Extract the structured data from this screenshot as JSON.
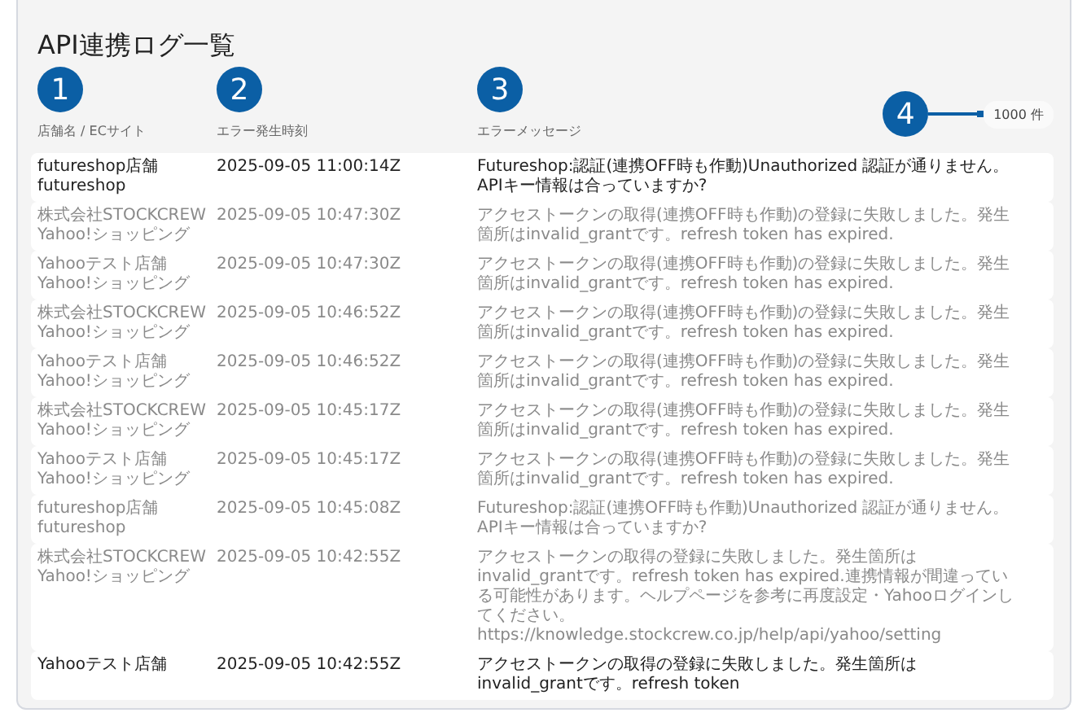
{
  "title": "API連携ログ一覧",
  "markers": [
    {
      "label": "1"
    },
    {
      "label": "2"
    },
    {
      "label": "3"
    },
    {
      "label": "4"
    }
  ],
  "columns": [
    "店舗名 / ECサイト",
    "エラー発生時刻",
    "エラーメッセージ"
  ],
  "count": "1000 件",
  "rows": [
    {
      "shop": "futureshop店舗",
      "site": "futureshop",
      "time": "2025-09-05 11:00:14Z",
      "message": "Futureshop:認証(連携OFF時も作動)Unauthorized 認証が通りません。APIキー情報は合っていますか?",
      "faded": false
    },
    {
      "shop": "株式会社STOCKCREW",
      "site": "Yahoo!ショッピング",
      "time": "2025-09-05 10:47:30Z",
      "message": "アクセストークンの取得(連携OFF時も作動)の登録に失敗しました。発生箇所はinvalid_grantです。refresh token has expired.",
      "faded": true
    },
    {
      "shop": "Yahooテスト店舗",
      "site": "Yahoo!ショッピング",
      "time": "2025-09-05 10:47:30Z",
      "message": "アクセストークンの取得(連携OFF時も作動)の登録に失敗しました。発生箇所はinvalid_grantです。refresh token has expired.",
      "faded": true
    },
    {
      "shop": "株式会社STOCKCREW",
      "site": "Yahoo!ショッピング",
      "time": "2025-09-05 10:46:52Z",
      "message": "アクセストークンの取得(連携OFF時も作動)の登録に失敗しました。発生箇所はinvalid_grantです。refresh token has expired.",
      "faded": true
    },
    {
      "shop": "Yahooテスト店舗",
      "site": "Yahoo!ショッピング",
      "time": "2025-09-05 10:46:52Z",
      "message": "アクセストークンの取得(連携OFF時も作動)の登録に失敗しました。発生箇所はinvalid_grantです。refresh token has expired.",
      "faded": true
    },
    {
      "shop": "株式会社STOCKCREW",
      "site": "Yahoo!ショッピング",
      "time": "2025-09-05 10:45:17Z",
      "message": "アクセストークンの取得(連携OFF時も作動)の登録に失敗しました。発生箇所はinvalid_grantです。refresh token has expired.",
      "faded": true
    },
    {
      "shop": "Yahooテスト店舗",
      "site": "Yahoo!ショッピング",
      "time": "2025-09-05 10:45:17Z",
      "message": "アクセストークンの取得(連携OFF時も作動)の登録に失敗しました。発生箇所はinvalid_grantです。refresh token has expired.",
      "faded": true
    },
    {
      "shop": "futureshop店舗",
      "site": "futureshop",
      "time": "2025-09-05 10:45:08Z",
      "message": "Futureshop:認証(連携OFF時も作動)Unauthorized 認証が通りません。APIキー情報は合っていますか?",
      "faded": true
    },
    {
      "shop": "株式会社STOCKCREW",
      "site": "Yahoo!ショッピング",
      "time": "2025-09-05 10:42:55Z",
      "message": "アクセストークンの取得の登録に失敗しました。発生箇所はinvalid_grantです。refresh token has expired.連携情報が間違っている可能性があります。ヘルプページを参考に再度設定・Yahooログインしてください。https://knowledge.stockcrew.co.jp/help/api/yahoo/setting",
      "faded": true
    },
    {
      "shop": "Yahooテスト店舗",
      "time": "2025-09-05 10:42:55Z",
      "message": "アクセストークンの取得の登録に失敗しました。発生箇所はinvalid_grantです。refresh token",
      "faded": false
    }
  ]
}
